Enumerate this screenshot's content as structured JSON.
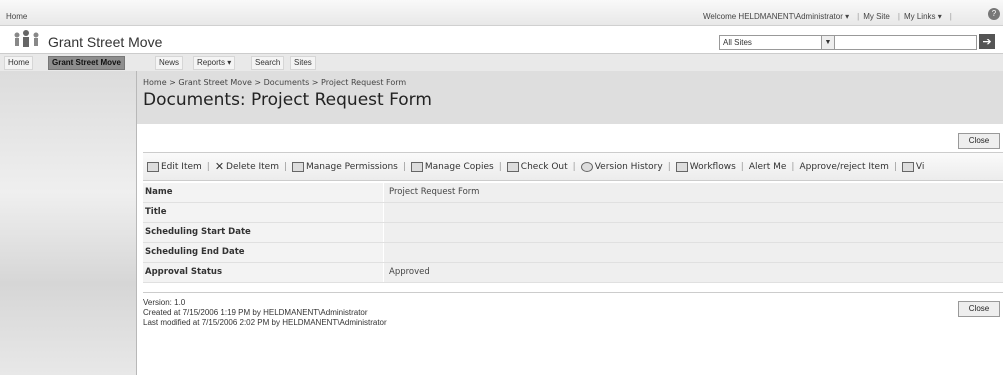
{
  "topbar": {
    "home": "Home",
    "welcome": "Welcome HELDMANENT\\Administrator ▾",
    "my_site": "My Site",
    "my_links": "My Links ▾",
    "help_icon": "?"
  },
  "site": {
    "title": "Grant Street Move",
    "search_scope": "All Sites",
    "search_value": ""
  },
  "nav": [
    "Home",
    "Grant Street Move",
    "News",
    "Reports ▾",
    "Search",
    "Sites"
  ],
  "page": {
    "breadcrumb": "Home > Grant Street Move > Documents > Project Request Form",
    "title": "Documents: Project Request Form",
    "close": "Close"
  },
  "toolbar": [
    {
      "label": "Edit Item",
      "icon": "edit-icon"
    },
    {
      "label": "Delete Item",
      "icon": "delete-icon"
    },
    {
      "label": "Manage Permissions",
      "icon": "permissions-icon"
    },
    {
      "label": "Manage Copies",
      "icon": "copies-icon"
    },
    {
      "label": "Check Out",
      "icon": "checkout-icon"
    },
    {
      "label": "Version History",
      "icon": "version-history-icon"
    },
    {
      "label": "Workflows",
      "icon": "workflows-icon"
    },
    {
      "label": "Alert Me",
      "icon": ""
    },
    {
      "label": "Approve/reject Item",
      "icon": ""
    },
    {
      "label": "Vi",
      "icon": "view-icon"
    }
  ],
  "fields": [
    {
      "label": "Name",
      "value": "Project Request Form"
    },
    {
      "label": "Title",
      "value": ""
    },
    {
      "label": "Scheduling Start Date",
      "value": ""
    },
    {
      "label": "Scheduling End Date",
      "value": ""
    },
    {
      "label": "Approval Status",
      "value": "Approved"
    }
  ],
  "footer": {
    "version": "Version: 1.0",
    "created": "Created at 7/15/2006 1:19 PM  by HELDMANENT\\Administrator",
    "modified": "Last modified at 7/15/2006 2:02 PM  by HELDMANENT\\Administrator"
  }
}
